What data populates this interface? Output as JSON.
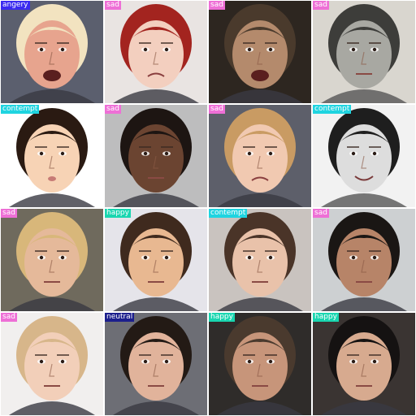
{
  "label_colors": {
    "angery": "#3b2bf0",
    "sad": "#ee6fd6",
    "contempt": "#1fd4e0",
    "happy": "#19d6b0",
    "neutral": "#1c1f8c"
  },
  "tiles": [
    {
      "label": "angery",
      "bg": "#5b5f6e",
      "skin": "#e7a48e",
      "hair": "#f2e3c0",
      "mood": "angry",
      "tone": "color"
    },
    {
      "label": "sad",
      "bg": "#e9e4e2",
      "skin": "#f3cfbf",
      "hair": "#a3241f",
      "mood": "sad",
      "tone": "color"
    },
    {
      "label": "sad",
      "bg": "#2d2620",
      "skin": "#b48a6c",
      "hair": "#4a3a2c",
      "mood": "open",
      "tone": "color"
    },
    {
      "label": "sad",
      "bg": "#d9d6cf",
      "skin": "#a8a8a2",
      "hair": "#3d3d3a",
      "mood": "neutral",
      "tone": "mono"
    },
    {
      "label": "contempt",
      "bg": "#ffffff",
      "skin": "#f7d3b5",
      "hair": "#2a1a12",
      "mood": "pout",
      "tone": "color"
    },
    {
      "label": "sad",
      "bg": "#bdbdbe",
      "skin": "#6b4431",
      "hair": "#1d1512",
      "mood": "neutral",
      "tone": "color"
    },
    {
      "label": "sad",
      "bg": "#5d5f6a",
      "skin": "#f1c9b1",
      "hair": "#c99b63",
      "mood": "cry",
      "tone": "color"
    },
    {
      "label": "contempt",
      "bg": "#f2f2f2",
      "skin": "#dddddd",
      "hair": "#1e1e1e",
      "mood": "smile",
      "tone": "mono"
    },
    {
      "label": "sad",
      "bg": "#6f6a5d",
      "skin": "#e5b99a",
      "hair": "#d8b77a",
      "mood": "neutral",
      "tone": "color"
    },
    {
      "label": "happy",
      "bg": "#e5e4ea",
      "skin": "#e8b891",
      "hair": "#3f2a1e",
      "mood": "neutral",
      "tone": "color"
    },
    {
      "label": "contempt",
      "bg": "#c9c3bf",
      "skin": "#e9c2aa",
      "hair": "#4a3428",
      "mood": "neutral",
      "tone": "color"
    },
    {
      "label": "sad",
      "bg": "#cdd0d2",
      "skin": "#b78468",
      "hair": "#1a1614",
      "mood": "neutral",
      "tone": "color"
    },
    {
      "label": "sad",
      "bg": "#f1efee",
      "skin": "#f2cfb9",
      "hair": "#d7b68a",
      "mood": "neutral",
      "tone": "color"
    },
    {
      "label": "neutral",
      "bg": "#6d6e75",
      "skin": "#e1b39b",
      "hair": "#231a15",
      "mood": "neutral",
      "tone": "color"
    },
    {
      "label": "happy",
      "bg": "#2f2c2a",
      "skin": "#c7957a",
      "hair": "#4a3a2e",
      "mood": "neutral",
      "tone": "color"
    },
    {
      "label": "happy",
      "bg": "#3a3432",
      "skin": "#d7aa8f",
      "hair": "#151212",
      "mood": "neutral",
      "tone": "color"
    }
  ]
}
